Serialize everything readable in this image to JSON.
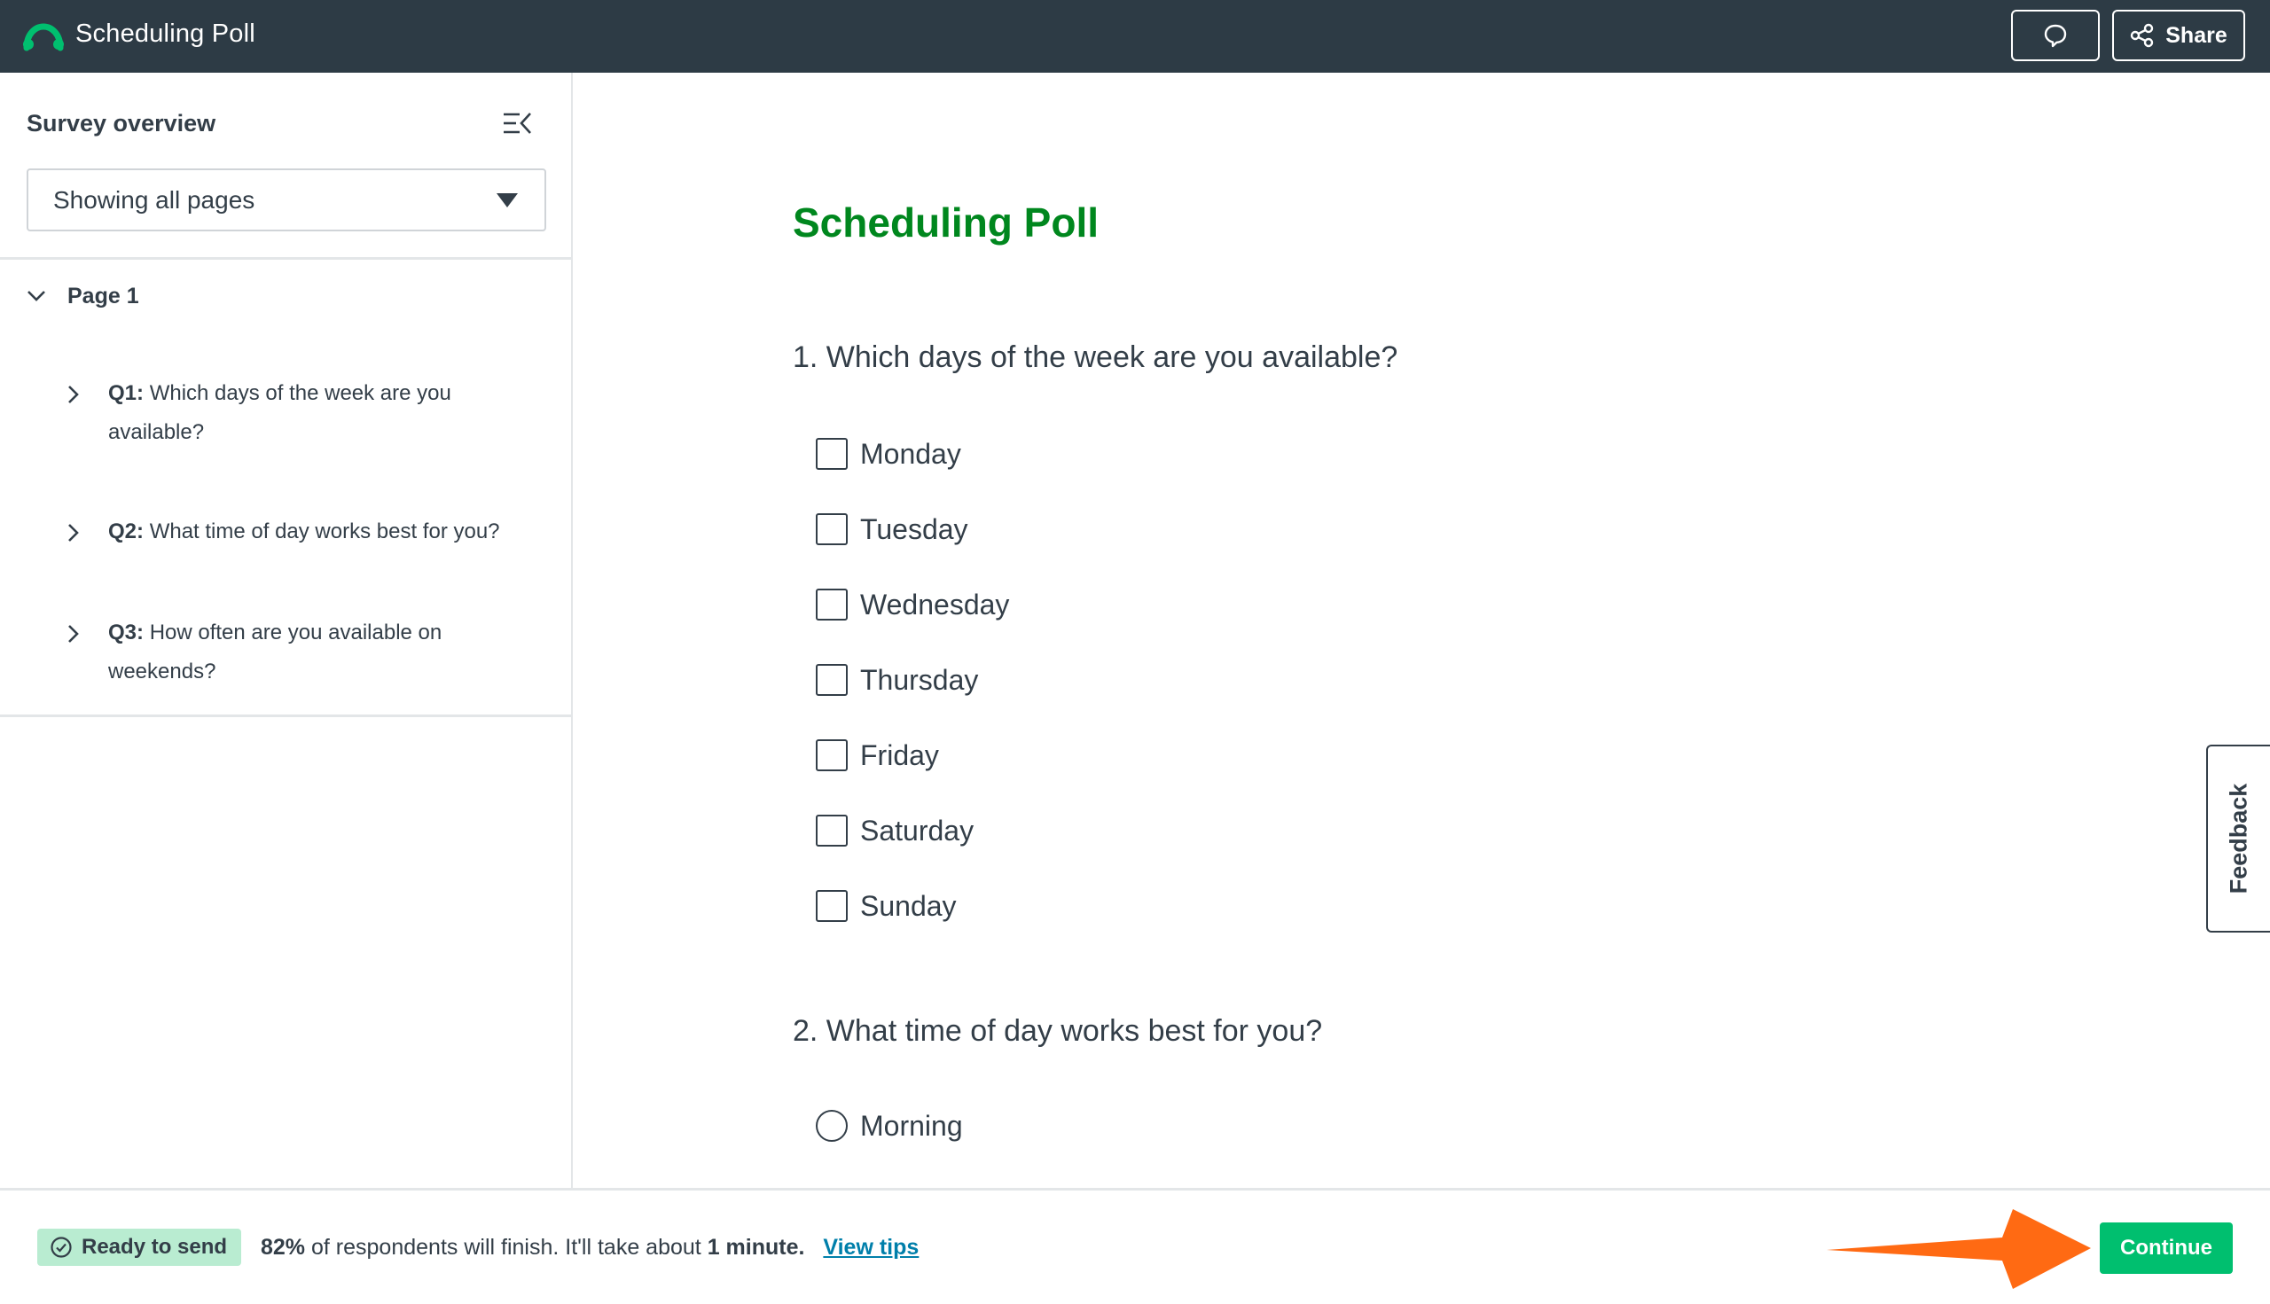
{
  "app": {
    "title": "Scheduling Poll",
    "share_label": "Share"
  },
  "sidebar": {
    "heading": "Survey overview",
    "page_filter": "Showing all pages",
    "page_label": "Page 1",
    "questions": [
      {
        "num": "Q1:",
        "text": "Which days of the week are you available?"
      },
      {
        "num": "Q2:",
        "text": "What time of day works best for you?"
      },
      {
        "num": "Q3:",
        "text": "How often are you available on weekends?"
      }
    ]
  },
  "survey": {
    "title": "Scheduling Poll",
    "q1": {
      "title": "1. Which days of the week are you available?",
      "options": [
        "Monday",
        "Tuesday",
        "Wednesday",
        "Thursday",
        "Friday",
        "Saturday",
        "Sunday"
      ]
    },
    "q2": {
      "title": "2. What time of day works best for you?",
      "options": [
        "Morning"
      ]
    }
  },
  "feedback_label": "Feedback",
  "footer": {
    "badge": "Ready to send",
    "percent": "82%",
    "msg_mid": " of respondents will finish. It'll take about ",
    "duration": "1 minute.",
    "tips_link": "View tips",
    "continue_label": "Continue"
  },
  "colors": {
    "topbar": "#2d3b45",
    "brand_green": "#00bf6f",
    "title_green": "#00871e",
    "badge_bg": "#b9ecd1",
    "link": "#007faa",
    "annotation_arrow": "#ff6a13"
  },
  "icons": {
    "logo": "surveymonkey-logo-icon",
    "comment": "comment-bubble-icon",
    "share": "share-nodes-icon",
    "collapse": "collapse-sidebar-icon",
    "dropdown": "caret-down-icon",
    "ready": "check-circle-icon"
  }
}
